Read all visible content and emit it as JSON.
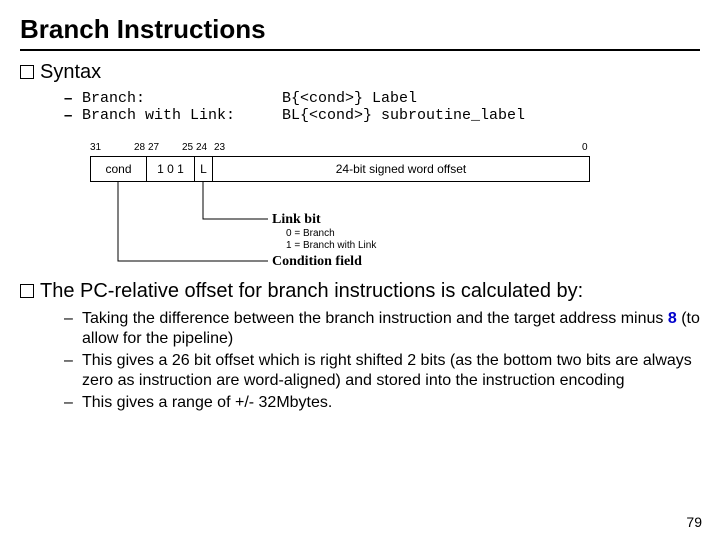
{
  "title": "Branch Instructions",
  "syntax": {
    "heading": "Syntax",
    "rows": [
      {
        "label": "Branch:",
        "code": "B{<cond>} Label"
      },
      {
        "label": "Branch with Link:",
        "code": "BL{<cond>} subroutine_label"
      }
    ]
  },
  "encoding": {
    "bits": {
      "b31": "31",
      "b28": "28",
      "b27": "27",
      "b25": "25",
      "b24": "24",
      "b23": "23",
      "b0": "0"
    },
    "cells": {
      "cond": "cond",
      "op": "1 0 1",
      "l": "L",
      "offset": "24-bit signed word offset"
    },
    "linkbit": {
      "label": "Link bit",
      "v0": "0 = Branch",
      "v1": "1 = Branch with Link"
    },
    "condfield": "Condition field"
  },
  "pcrel": {
    "heading": "The PC-relative offset for branch instructions is calculated by:",
    "bullets": {
      "b0a": "Taking the difference between the branch instruction and the target address minus ",
      "b0num": "8",
      "b0b": " (to allow for the pipeline)",
      "b1": "This gives a 26 bit offset which is right shifted 2 bits (as the bottom two bits are always zero as instruction are word-aligned) and stored into the instruction encoding",
      "b2": "This gives a range of +/- 32Mbytes."
    }
  },
  "page": "79"
}
